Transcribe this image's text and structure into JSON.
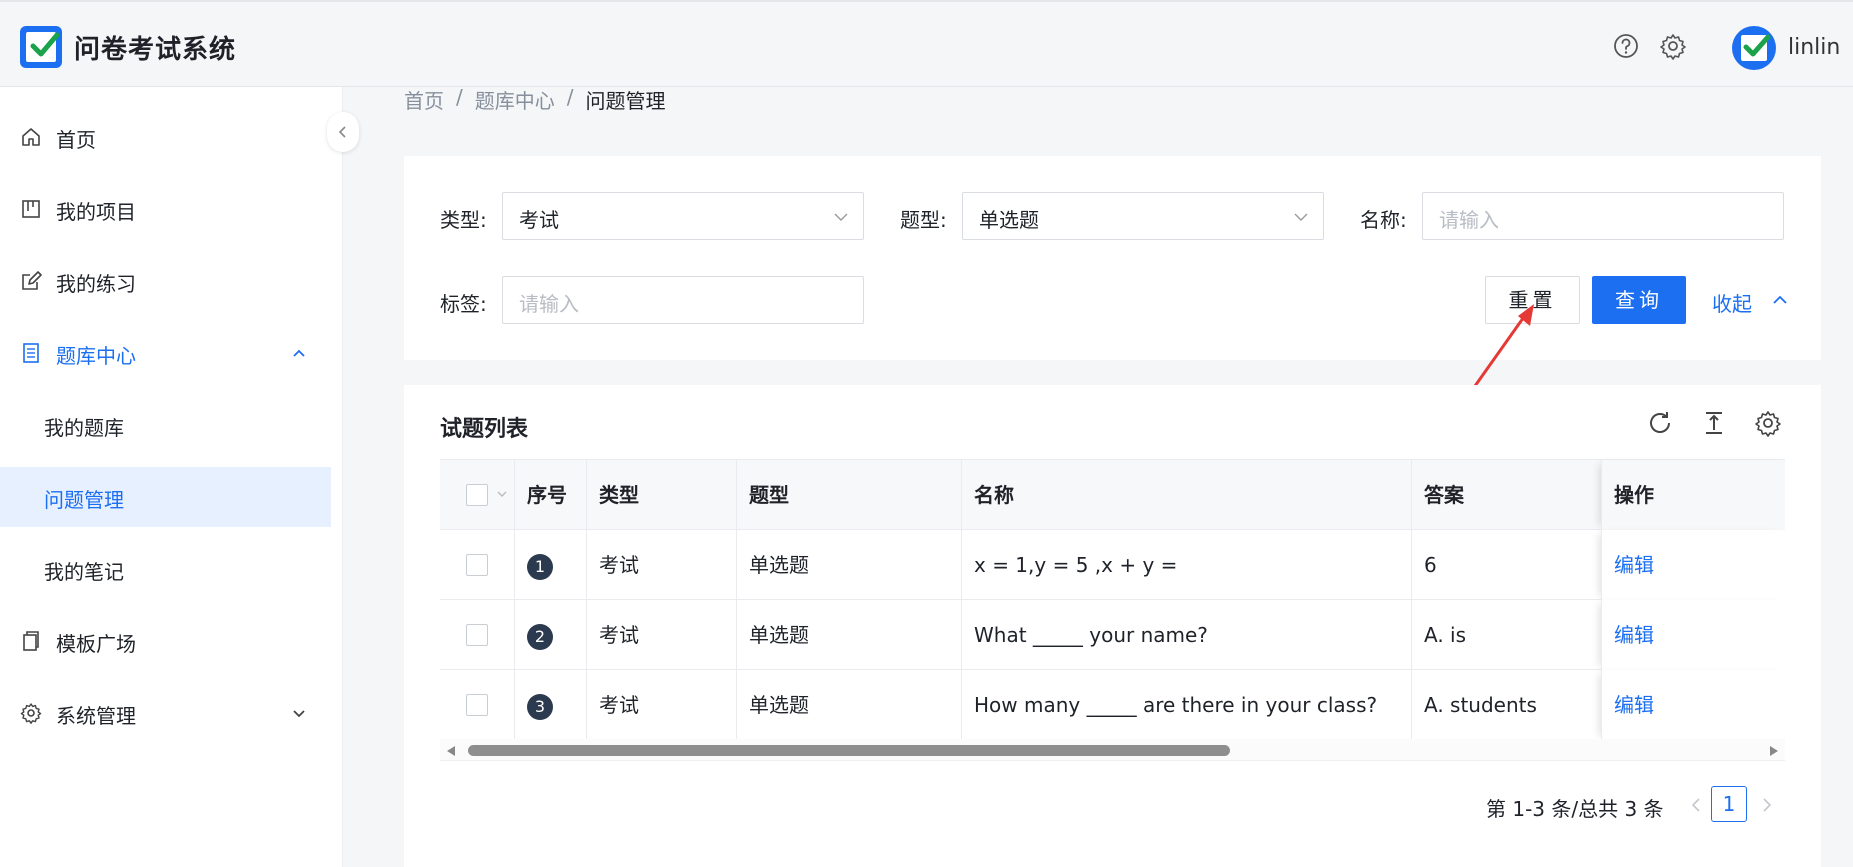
{
  "header": {
    "app_title": "问卷考试系统",
    "username": "linlin",
    "icons": [
      "help-icon",
      "settings-icon"
    ]
  },
  "sidebar": {
    "items": [
      {
        "label": "首页",
        "icon": "home-icon"
      },
      {
        "label": "我的项目",
        "icon": "project-icon"
      },
      {
        "label": "我的练习",
        "icon": "edit-icon"
      },
      {
        "label": "题库中心",
        "icon": "library-icon",
        "expanded": true
      },
      {
        "label": "我的题库",
        "sub": true
      },
      {
        "label": "问题管理",
        "sub": true,
        "selected": true
      },
      {
        "label": "我的笔记",
        "sub": true
      },
      {
        "label": "模板广场",
        "icon": "template-icon"
      },
      {
        "label": "系统管理",
        "icon": "gear-icon"
      }
    ]
  },
  "breadcrumb": {
    "items": [
      "首页",
      "题库中心",
      "问题管理"
    ],
    "separator": "/"
  },
  "filter": {
    "type_label": "类型:",
    "type_value": "考试",
    "qtype_label": "题型:",
    "qtype_value": "单选题",
    "name_label": "名称:",
    "name_placeholder": "请输入",
    "tag_label": "标签:",
    "tag_placeholder": "请输入",
    "reset_label": "重置",
    "query_label": "查询",
    "collapse_label": "收起"
  },
  "table": {
    "title": "试题列表",
    "headers": {
      "index": "序号",
      "type": "类型",
      "qtype": "题型",
      "name": "名称",
      "answer": "答案",
      "op": "操作"
    },
    "rows": [
      {
        "index": "1",
        "type": "考试",
        "qtype": "单选题",
        "name": "x = 1,y = 5 ,x + y =",
        "answer": "6",
        "op": "编辑"
      },
      {
        "index": "2",
        "type": "考试",
        "qtype": "单选题",
        "name": "What _____ your name?",
        "answer": "A. is",
        "op": "编辑"
      },
      {
        "index": "3",
        "type": "考试",
        "qtype": "单选题",
        "name": "How many _____ are there in your class?",
        "answer": "A. students",
        "op": "编辑"
      }
    ]
  },
  "pagination": {
    "summary": "第 1-3 条/总共 3 条",
    "current": "1"
  },
  "colors": {
    "primary": "#1d6ff2",
    "annotation": "#e53935"
  }
}
